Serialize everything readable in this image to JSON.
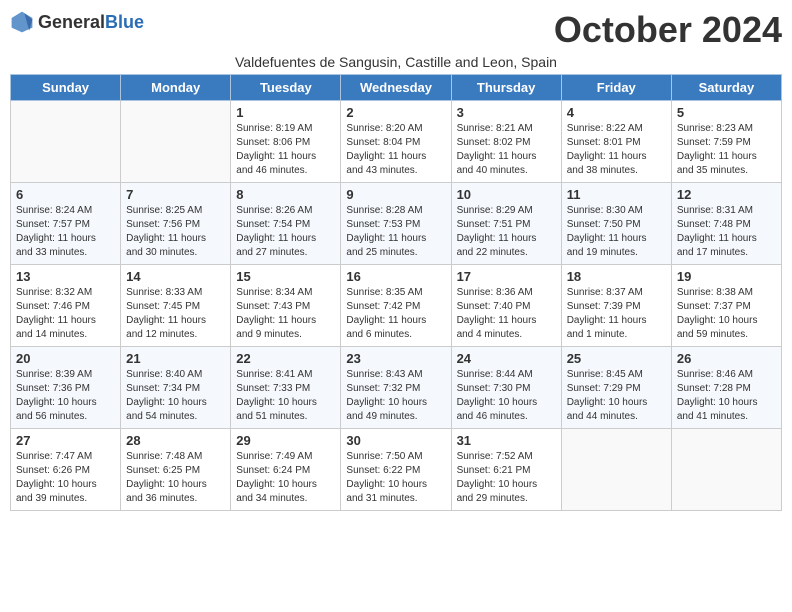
{
  "logo": {
    "general": "General",
    "blue": "Blue"
  },
  "title": "October 2024",
  "subtitle": "Valdefuentes de Sangusin, Castille and Leon, Spain",
  "days_header": [
    "Sunday",
    "Monday",
    "Tuesday",
    "Wednesday",
    "Thursday",
    "Friday",
    "Saturday"
  ],
  "weeks": [
    [
      {
        "day": "",
        "info": ""
      },
      {
        "day": "",
        "info": ""
      },
      {
        "day": "1",
        "info": "Sunrise: 8:19 AM\nSunset: 8:06 PM\nDaylight: 11 hours and 46 minutes."
      },
      {
        "day": "2",
        "info": "Sunrise: 8:20 AM\nSunset: 8:04 PM\nDaylight: 11 hours and 43 minutes."
      },
      {
        "day": "3",
        "info": "Sunrise: 8:21 AM\nSunset: 8:02 PM\nDaylight: 11 hours and 40 minutes."
      },
      {
        "day": "4",
        "info": "Sunrise: 8:22 AM\nSunset: 8:01 PM\nDaylight: 11 hours and 38 minutes."
      },
      {
        "day": "5",
        "info": "Sunrise: 8:23 AM\nSunset: 7:59 PM\nDaylight: 11 hours and 35 minutes."
      }
    ],
    [
      {
        "day": "6",
        "info": "Sunrise: 8:24 AM\nSunset: 7:57 PM\nDaylight: 11 hours and 33 minutes."
      },
      {
        "day": "7",
        "info": "Sunrise: 8:25 AM\nSunset: 7:56 PM\nDaylight: 11 hours and 30 minutes."
      },
      {
        "day": "8",
        "info": "Sunrise: 8:26 AM\nSunset: 7:54 PM\nDaylight: 11 hours and 27 minutes."
      },
      {
        "day": "9",
        "info": "Sunrise: 8:28 AM\nSunset: 7:53 PM\nDaylight: 11 hours and 25 minutes."
      },
      {
        "day": "10",
        "info": "Sunrise: 8:29 AM\nSunset: 7:51 PM\nDaylight: 11 hours and 22 minutes."
      },
      {
        "day": "11",
        "info": "Sunrise: 8:30 AM\nSunset: 7:50 PM\nDaylight: 11 hours and 19 minutes."
      },
      {
        "day": "12",
        "info": "Sunrise: 8:31 AM\nSunset: 7:48 PM\nDaylight: 11 hours and 17 minutes."
      }
    ],
    [
      {
        "day": "13",
        "info": "Sunrise: 8:32 AM\nSunset: 7:46 PM\nDaylight: 11 hours and 14 minutes."
      },
      {
        "day": "14",
        "info": "Sunrise: 8:33 AM\nSunset: 7:45 PM\nDaylight: 11 hours and 12 minutes."
      },
      {
        "day": "15",
        "info": "Sunrise: 8:34 AM\nSunset: 7:43 PM\nDaylight: 11 hours and 9 minutes."
      },
      {
        "day": "16",
        "info": "Sunrise: 8:35 AM\nSunset: 7:42 PM\nDaylight: 11 hours and 6 minutes."
      },
      {
        "day": "17",
        "info": "Sunrise: 8:36 AM\nSunset: 7:40 PM\nDaylight: 11 hours and 4 minutes."
      },
      {
        "day": "18",
        "info": "Sunrise: 8:37 AM\nSunset: 7:39 PM\nDaylight: 11 hours and 1 minute."
      },
      {
        "day": "19",
        "info": "Sunrise: 8:38 AM\nSunset: 7:37 PM\nDaylight: 10 hours and 59 minutes."
      }
    ],
    [
      {
        "day": "20",
        "info": "Sunrise: 8:39 AM\nSunset: 7:36 PM\nDaylight: 10 hours and 56 minutes."
      },
      {
        "day": "21",
        "info": "Sunrise: 8:40 AM\nSunset: 7:34 PM\nDaylight: 10 hours and 54 minutes."
      },
      {
        "day": "22",
        "info": "Sunrise: 8:41 AM\nSunset: 7:33 PM\nDaylight: 10 hours and 51 minutes."
      },
      {
        "day": "23",
        "info": "Sunrise: 8:43 AM\nSunset: 7:32 PM\nDaylight: 10 hours and 49 minutes."
      },
      {
        "day": "24",
        "info": "Sunrise: 8:44 AM\nSunset: 7:30 PM\nDaylight: 10 hours and 46 minutes."
      },
      {
        "day": "25",
        "info": "Sunrise: 8:45 AM\nSunset: 7:29 PM\nDaylight: 10 hours and 44 minutes."
      },
      {
        "day": "26",
        "info": "Sunrise: 8:46 AM\nSunset: 7:28 PM\nDaylight: 10 hours and 41 minutes."
      }
    ],
    [
      {
        "day": "27",
        "info": "Sunrise: 7:47 AM\nSunset: 6:26 PM\nDaylight: 10 hours and 39 minutes."
      },
      {
        "day": "28",
        "info": "Sunrise: 7:48 AM\nSunset: 6:25 PM\nDaylight: 10 hours and 36 minutes."
      },
      {
        "day": "29",
        "info": "Sunrise: 7:49 AM\nSunset: 6:24 PM\nDaylight: 10 hours and 34 minutes."
      },
      {
        "day": "30",
        "info": "Sunrise: 7:50 AM\nSunset: 6:22 PM\nDaylight: 10 hours and 31 minutes."
      },
      {
        "day": "31",
        "info": "Sunrise: 7:52 AM\nSunset: 6:21 PM\nDaylight: 10 hours and 29 minutes."
      },
      {
        "day": "",
        "info": ""
      },
      {
        "day": "",
        "info": ""
      }
    ]
  ]
}
